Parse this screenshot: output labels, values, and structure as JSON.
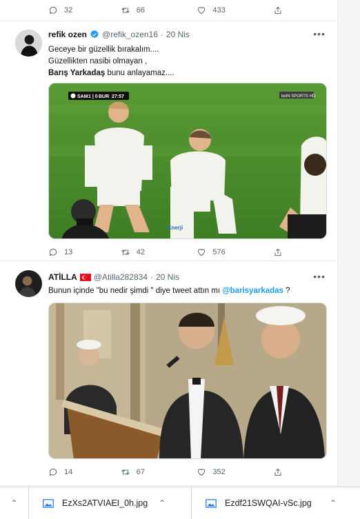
{
  "top_tweet_actions": {
    "replies": "32",
    "retweets": "66",
    "likes": "433"
  },
  "tweets": [
    {
      "name": "refik ozen",
      "handle": "@refik_ozen16",
      "separator": "·",
      "date": "20 Nis",
      "lines": [
        "Geceye bir güzellik bırakalım....",
        "Güzellikten  nasibi olmayan ,"
      ],
      "bold_line": "Barış Yarkadaş",
      "bold_line_rest": " bunu anlayamaz....",
      "scoreboard": {
        "home": "SAM",
        "score": "1 | 0",
        "away": "BUR",
        "time": "27:57",
        "channel": "beIN SPORTS HD"
      },
      "sponsor": "Enerji",
      "actions": {
        "replies": "13",
        "retweets": "42",
        "likes": "576"
      }
    },
    {
      "name": "ATİLLA",
      "handle": "@Atilla282834",
      "separator": "·",
      "date": "20 Nis",
      "text_before": "Bunun içinde \"bu nedir şimdi \" diye tweet attın mı ",
      "mention": "@barisyarkadas",
      "text_after": " ?",
      "actions": {
        "replies": "14",
        "retweets": "67",
        "likes": "352"
      }
    }
  ],
  "downloads": [
    {
      "filename": "EzXs2ATVIAEI_0h.jpg"
    },
    {
      "filename": "Ezdf21SWQAI-vSc.jpg"
    }
  ],
  "colors": {
    "link": "#1d9bf0",
    "verified": "#1d9bf0",
    "pitch": "#4f8f2e",
    "turkish_flag": "#e30a17"
  }
}
